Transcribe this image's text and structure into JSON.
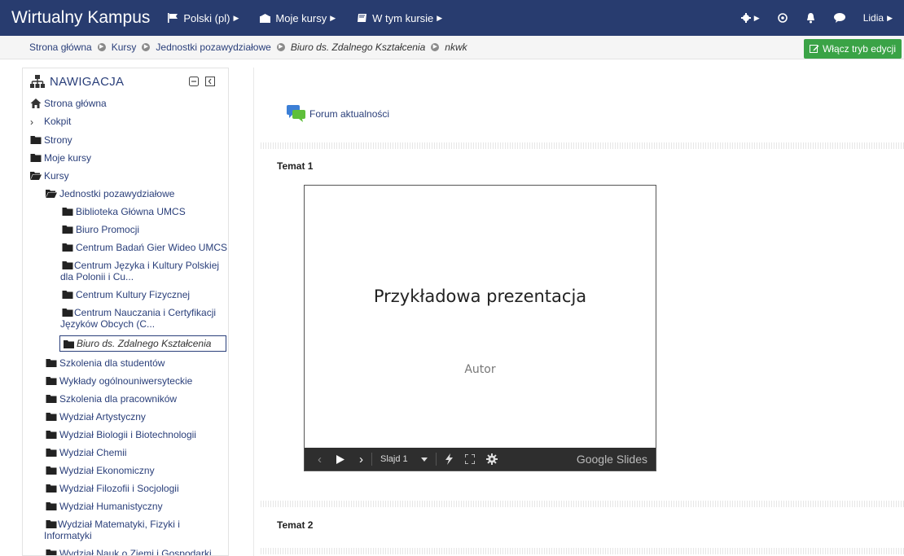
{
  "app": {
    "brand": "Wirtualny Kampus",
    "language": "Polski (pl)",
    "my_courses": "Moje kursy",
    "in_course": "W tym kursie",
    "user": "Lidia"
  },
  "breadcrumb": [
    "Strona główna",
    "Kursy",
    "Jednostki pozawydziałowe",
    "Biuro ds. Zdalnego Kształcenia",
    "nkwk"
  ],
  "edit_button": "Włącz tryb edycji",
  "navigation": {
    "title": "NAWIGACJA",
    "home": "Strona główna",
    "dashboard": "Kokpit",
    "pages": "Strony",
    "my_courses": "Moje kursy",
    "courses": "Kursy",
    "units": "Jednostki pozawydziałowe",
    "units_children": [
      "Biblioteka Główna UMCS",
      "Biuro Promocji",
      "Centrum Badań Gier Wideo UMCS",
      "Centrum Języka i Kultury Polskiej dla Polonii i Cu...",
      "Centrum Kultury Fizycznej",
      "Centrum Nauczania i Certyfikacji Języków Obcych (C..."
    ],
    "current": "Biuro ds. Zdalnego Kształcenia",
    "categories": [
      "Szkolenia dla studentów",
      "Wykłady ogólnouniwersyteckie",
      "Szkolenia dla pracowników",
      "Wydział Artystyczny",
      "Wydział Biologii i Biotechnologii",
      "Wydział Chemii",
      "Wydział Ekonomiczny",
      "Wydział Filozofii i Socjologii",
      "Wydział Humanistyczny",
      "Wydział Matematyki, Fizyki i Informatyki",
      "Wydział Nauk o Ziemi i Gospodarki"
    ]
  },
  "content": {
    "forum": "Forum aktualności",
    "topic1": "Temat 1",
    "topic2": "Temat 2",
    "slide": {
      "title": "Przykładowa prezentacja",
      "author": "Autor",
      "slide_label": "Slajd 1",
      "brand": "Google Slides"
    }
  }
}
